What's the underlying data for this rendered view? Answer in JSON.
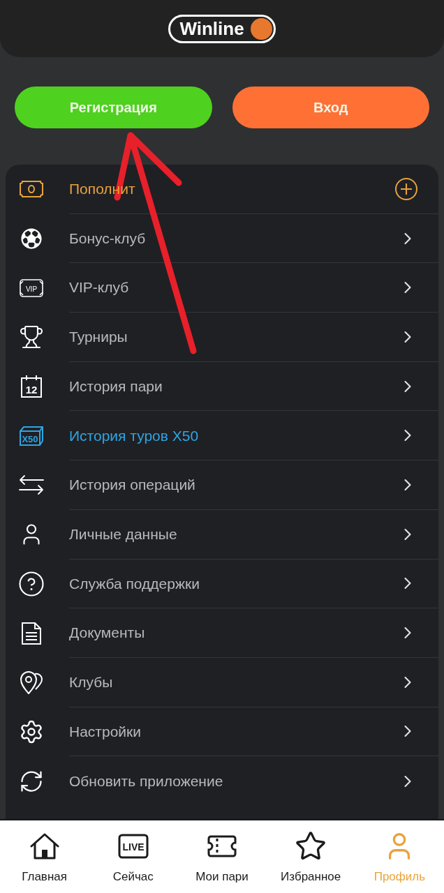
{
  "header": {
    "logo": "Winline"
  },
  "auth_buttons": [
    {
      "label": "Регистрация",
      "kind": "register"
    },
    {
      "label": "Вход",
      "kind": "login"
    }
  ],
  "menu": [
    {
      "label": "Пополнит",
      "kind": "deposit"
    },
    {
      "label": "Бонус-клуб",
      "kind": "link"
    },
    {
      "label": "VIP-клуб",
      "kind": "link",
      "icon_text": "VIP"
    },
    {
      "label": "Турниры",
      "kind": "link"
    },
    {
      "label": "История пари",
      "kind": "link",
      "icon_text": "12"
    },
    {
      "label": "История туров X50",
      "kind": "highlight",
      "icon_text": "X50"
    },
    {
      "label": "История операций",
      "kind": "link"
    },
    {
      "label": "Личные данные",
      "kind": "link"
    },
    {
      "label": "Служба поддержки",
      "kind": "link"
    },
    {
      "label": "Документы",
      "kind": "link"
    },
    {
      "label": "Клубы",
      "kind": "link"
    },
    {
      "label": "Настройки",
      "kind": "link"
    },
    {
      "label": "Обновить приложение",
      "kind": "link"
    }
  ],
  "bottom_nav": [
    {
      "label": "Главная",
      "selected": false
    },
    {
      "label": "Сейчас",
      "selected": false,
      "icon_text": "LIVE"
    },
    {
      "label": "Мои пари",
      "selected": false
    },
    {
      "label": "Избранное",
      "selected": false
    },
    {
      "label": "Профиль",
      "selected": true
    }
  ]
}
